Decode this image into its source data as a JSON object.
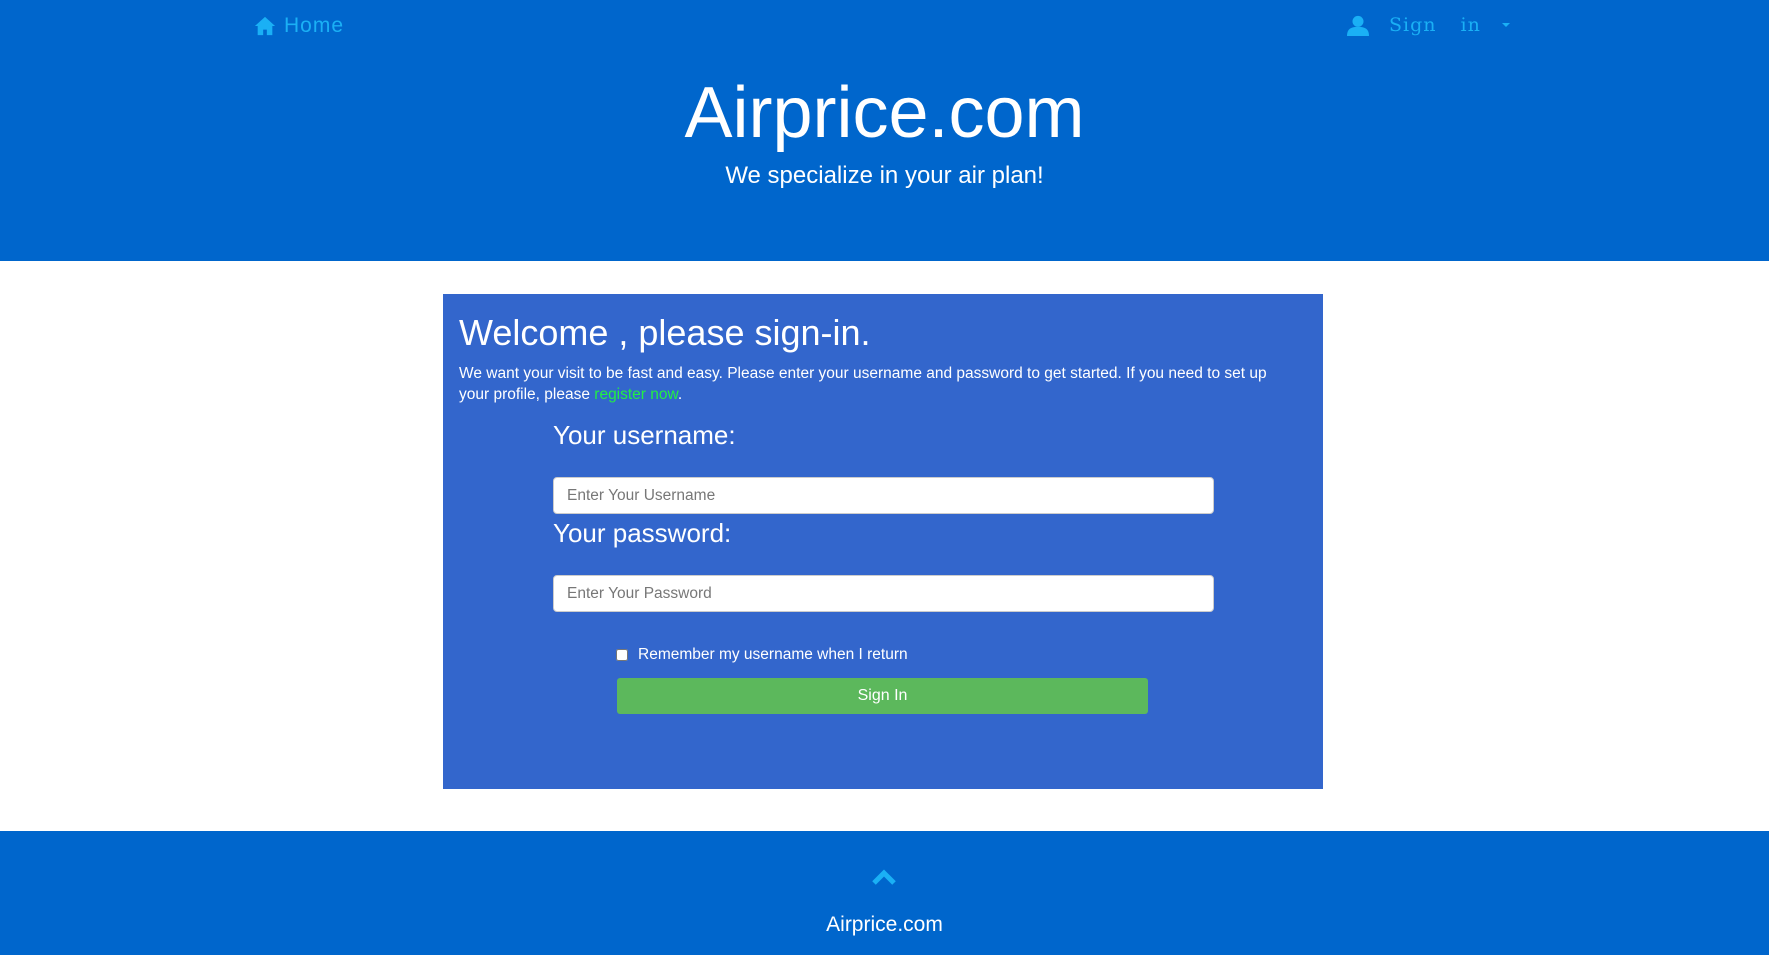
{
  "nav": {
    "home_label": "Home",
    "home_icon": "home-icon",
    "signin_word1": "Sign",
    "signin_word2": "in",
    "user_icon": "user-icon",
    "caret_icon": "caret-down-icon",
    "link_color": "#1ab0f5"
  },
  "header": {
    "title": "Airprice.com",
    "tagline": "We specialize in your air plan!",
    "background": "#0066cc"
  },
  "panel": {
    "heading": "Welcome , please sign-in.",
    "intro_text": "We want your visit to be fast and easy. Please enter your username and password to get started. If you need to set up your profile, please ",
    "register_link": "register now",
    "intro_end": ".",
    "background": "#3366cc",
    "link_color": "#22ee44"
  },
  "form": {
    "username_label": "Your username:",
    "username_placeholder": "Enter Your Username",
    "username_value": "",
    "password_label": "Your password:",
    "password_placeholder": "Enter Your Password",
    "password_value": "",
    "remember_label": "Remember my username when I return",
    "remember_checked": false,
    "submit_label": "Sign In",
    "submit_color": "#5cb85c"
  },
  "footer": {
    "up_icon": "chevron-up-icon",
    "site_name": "Airprice.com"
  }
}
